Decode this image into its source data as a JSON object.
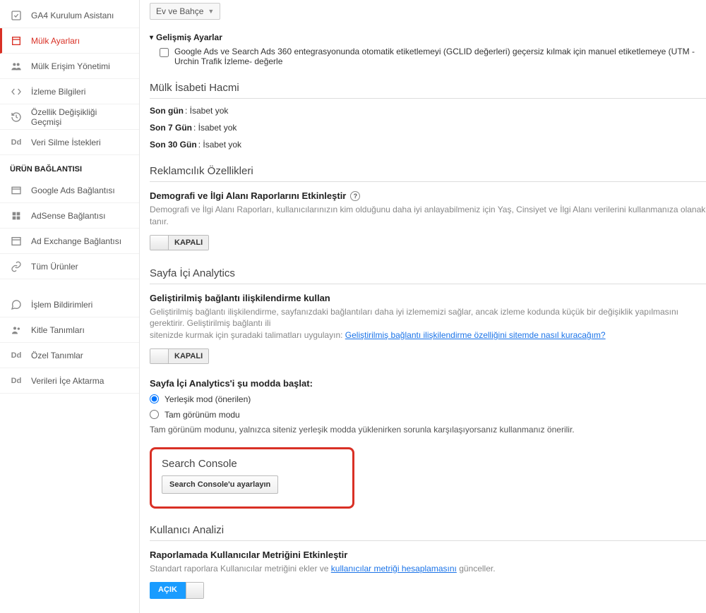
{
  "dropdown_selected": "Ev ve Bahçe",
  "sidebar": {
    "items": [
      {
        "label": "GA4 Kurulum Asistanı"
      },
      {
        "label": "Mülk Ayarları"
      },
      {
        "label": "Mülk Erişim Yönetimi"
      },
      {
        "label": "İzleme Bilgileri"
      },
      {
        "label": "Özellik Değişikliği Geçmişi"
      },
      {
        "label": "Veri Silme İstekleri"
      }
    ],
    "heading1": "ÜRÜN BAĞLANTISI",
    "items2": [
      {
        "label": "Google Ads Bağlantısı"
      },
      {
        "label": "AdSense Bağlantısı"
      },
      {
        "label": "Ad Exchange Bağlantısı"
      },
      {
        "label": "Tüm Ürünler"
      }
    ],
    "items3": [
      {
        "label": "İşlem Bildirimleri"
      },
      {
        "label": "Kitle Tanımları"
      },
      {
        "label": "Özel Tanımlar"
      },
      {
        "label": "Verileri İçe Aktarma"
      }
    ]
  },
  "advanced": {
    "title": "Gelişmiş Ayarlar",
    "checkbox_label": "Google Ads ve Search Ads 360 entegrasyonunda otomatik etiketlemeyi (GCLID değerleri) geçersiz kılmak için manuel etiketlemeye (UTM -Urchin Trafik İzleme- değerle"
  },
  "hit_volume": {
    "heading": "Mülk İsabeti Hacmi",
    "rows": [
      {
        "k": "Son gün",
        "v": ": İsabet yok"
      },
      {
        "k": "Son 7 Gün",
        "v": ": İsabet yok"
      },
      {
        "k": "Son 30 Gün",
        "v": ": İsabet yok"
      }
    ]
  },
  "advertising": {
    "heading": "Reklamcılık Özellikleri",
    "sub": "Demografi ve İlgi Alanı Raporlarını Etkinleştir",
    "desc": "Demografi ve İlgi Alanı Raporları, kullanıcılarınızın kim olduğunu daha iyi anlayabilmeniz için Yaş, Cinsiyet ve İlgi Alanı verilerini kullanmanıza olanak tanır.",
    "toggle_off": "KAPALI"
  },
  "inpage": {
    "heading": "Sayfa İçi Analytics",
    "sub": "Geliştirilmiş bağlantı ilişkilendirme kullan",
    "desc1": "Geliştirilmiş bağlantı ilişkilendirme, sayfanızdaki bağlantıları daha iyi izlememizi sağlar, ancak izleme kodunda küçük bir değişiklik yapılmasını gerektirir. Geliştirilmiş bağlantı ili",
    "desc2_a": "sitenizde kurmak için şuradaki talimatları uygulayın: ",
    "desc2_link": "Geliştirilmiş bağlantı ilişkilendirme özelliğini sitemde nasıl kuracağım?",
    "toggle_off": "KAPALI",
    "mode_label": "Sayfa İçi Analytics'i şu modda başlat:",
    "radio1": "Yerleşik mod (önerilen)",
    "radio2": "Tam görünüm modu",
    "mode_desc": "Tam görünüm modunu, yalnızca siteniz yerleşik modda yüklenirken sorunla karşılaşıyorsanız kullanmanız önerilir."
  },
  "search_console": {
    "heading": "Search Console",
    "button": "Search Console'u ayarlayın"
  },
  "user_analysis": {
    "heading": "Kullanıcı Analizi",
    "sub": "Raporlamada Kullanıcılar Metriğini Etkinleştir",
    "desc_a": "Standart raporlara Kullanıcılar metriğini ekler ve ",
    "desc_link": "kullanıcılar metriği hesaplamasını",
    "desc_b": " günceller.",
    "toggle_on": "AÇIK"
  }
}
